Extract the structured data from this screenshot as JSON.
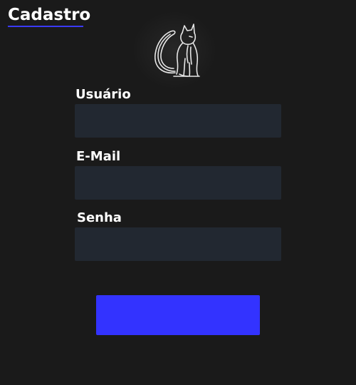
{
  "header": {
    "title": "Cadastro",
    "accent_color": "#3a3aff"
  },
  "logo": {
    "icon": "cat-icon"
  },
  "form": {
    "fields": [
      {
        "label": "Usuário",
        "value": "",
        "placeholder": ""
      },
      {
        "label": "E-Mail",
        "value": "",
        "placeholder": ""
      },
      {
        "label": "Senha",
        "value": "",
        "placeholder": ""
      }
    ],
    "submit": {
      "label": "",
      "color": "#3333ff"
    },
    "input_background": "#222831"
  },
  "page": {
    "background": "#1a1a1a"
  }
}
